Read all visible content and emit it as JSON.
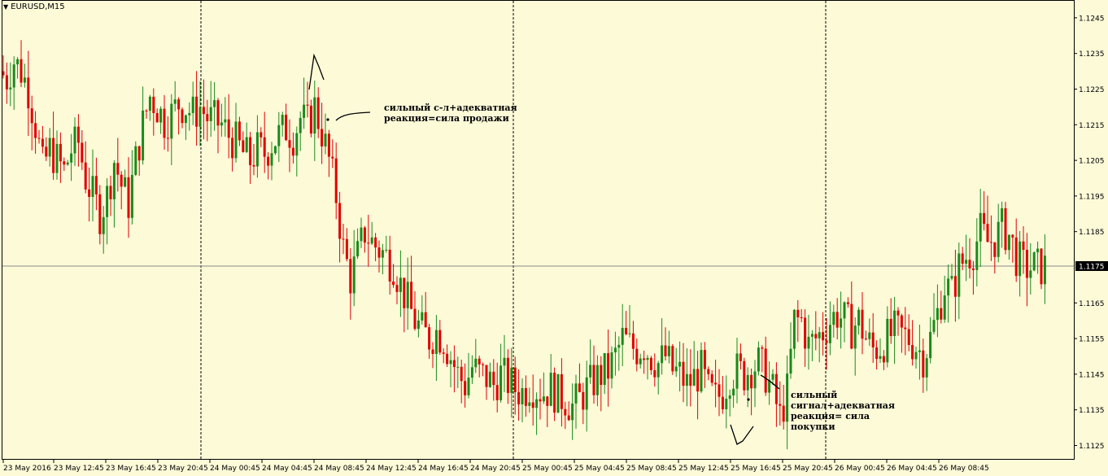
{
  "header": {
    "symbol": "EURUSD,M15"
  },
  "annotations": {
    "sell_note": "сильный с-л+адекватная\nреакция=сила продажи",
    "buy_note": "сильный\nсигнал+адекватная\nреакция= сила\nпокупки"
  },
  "colors": {
    "bull": "#1a8a1a",
    "bear": "#e00000",
    "background": "#fdfad8",
    "grid": "#000000",
    "price_line": "#8a8a8a"
  },
  "chart_data": {
    "type": "candlestick",
    "y_ticks": [
      "1.1245",
      "1.1235",
      "1.1225",
      "1.1215",
      "1.1205",
      "1.1195",
      "1.1185",
      "1.1165",
      "1.1155",
      "1.1145",
      "1.1135",
      "1.1125"
    ],
    "ylim": [
      1.1121,
      1.125
    ],
    "current_price": "1.1175",
    "x_ticks": [
      "23 May 2016",
      "23 May 12:45",
      "23 May 16:45",
      "23 May 20:45",
      "24 May 00:45",
      "24 May 04:45",
      "24 May 08:45",
      "24 May 12:45",
      "24 May 16:45",
      "24 May 20:45",
      "25 May 00:45",
      "25 May 04:45",
      "25 May 08:45",
      "25 May 12:45",
      "25 May 16:45",
      "25 May 20:45",
      "26 May 00:45",
      "26 May 04:45",
      "26 May 08:45"
    ],
    "session_separators": [
      "24 May 2016",
      "25 May 2016",
      "26 May 2016"
    ],
    "close_path": [
      [
        0,
        1.123
      ],
      [
        2,
        1.1228
      ],
      [
        4,
        1.1233
      ],
      [
        6,
        1.123
      ],
      [
        8,
        1.1225
      ],
      [
        10,
        1.1215
      ],
      [
        12,
        1.1203
      ],
      [
        14,
        1.1208
      ],
      [
        16,
        1.1205
      ],
      [
        18,
        1.1202
      ],
      [
        20,
        1.1208
      ],
      [
        22,
        1.121
      ],
      [
        24,
        1.12
      ],
      [
        26,
        1.1195
      ],
      [
        28,
        1.119
      ],
      [
        30,
        1.1195
      ],
      [
        32,
        1.1205
      ],
      [
        34,
        1.1198
      ],
      [
        36,
        1.1193
      ],
      [
        38,
        1.1205
      ],
      [
        40,
        1.1215
      ],
      [
        42,
        1.1223
      ],
      [
        44,
        1.122
      ],
      [
        46,
        1.1216
      ],
      [
        48,
        1.1218
      ],
      [
        50,
        1.1221
      ],
      [
        52,
        1.122
      ],
      [
        54,
        1.1218
      ],
      [
        56,
        1.122
      ],
      [
        58,
        1.1217
      ],
      [
        60,
        1.1216
      ],
      [
        62,
        1.1215
      ],
      [
        64,
        1.1212
      ],
      [
        66,
        1.121
      ],
      [
        68,
        1.1207
      ],
      [
        70,
        1.1205
      ],
      [
        72,
        1.1208
      ],
      [
        74,
        1.1207
      ],
      [
        76,
        1.121
      ],
      [
        78,
        1.1212
      ],
      [
        80,
        1.1214
      ],
      [
        82,
        1.1212
      ],
      [
        84,
        1.1217
      ],
      [
        86,
        1.1215
      ],
      [
        88,
        1.122
      ],
      [
        90,
        1.1213
      ],
      [
        92,
        1.1205
      ],
      [
        94,
        1.1195
      ],
      [
        96,
        1.118
      ],
      [
        98,
        1.1172
      ],
      [
        100,
        1.1178
      ],
      [
        102,
        1.1185
      ],
      [
        104,
        1.1182
      ],
      [
        106,
        1.118
      ],
      [
        108,
        1.1178
      ],
      [
        110,
        1.1176
      ],
      [
        112,
        1.117
      ],
      [
        114,
        1.1165
      ],
      [
        116,
        1.116
      ],
      [
        118,
        1.1157
      ],
      [
        120,
        1.1155
      ],
      [
        122,
        1.1157
      ],
      [
        124,
        1.1155
      ],
      [
        126,
        1.115
      ],
      [
        128,
        1.1145
      ],
      [
        130,
        1.1142
      ],
      [
        132,
        1.1147
      ],
      [
        134,
        1.1145
      ],
      [
        136,
        1.1144
      ],
      [
        138,
        1.1142
      ],
      [
        140,
        1.1145
      ],
      [
        142,
        1.1143
      ],
      [
        144,
        1.1141
      ],
      [
        146,
        1.114
      ],
      [
        148,
        1.1142
      ],
      [
        150,
        1.1141
      ],
      [
        152,
        1.114
      ],
      [
        154,
        1.1141
      ],
      [
        156,
        1.1139
      ],
      [
        158,
        1.1138
      ],
      [
        160,
        1.1136
      ],
      [
        162,
        1.1138
      ],
      [
        164,
        1.1141
      ],
      [
        166,
        1.1143
      ],
      [
        168,
        1.1145
      ],
      [
        170,
        1.1146
      ],
      [
        172,
        1.115
      ],
      [
        174,
        1.1155
      ],
      [
        176,
        1.1153
      ],
      [
        178,
        1.1152
      ],
      [
        180,
        1.1153
      ],
      [
        182,
        1.115
      ],
      [
        184,
        1.1148
      ],
      [
        186,
        1.115
      ],
      [
        188,
        1.1146
      ],
      [
        190,
        1.1145
      ],
      [
        192,
        1.1142
      ],
      [
        194,
        1.1144
      ],
      [
        196,
        1.1146
      ],
      [
        198,
        1.114
      ],
      [
        200,
        1.1138
      ],
      [
        202,
        1.114
      ],
      [
        204,
        1.1145
      ],
      [
        206,
        1.1146
      ],
      [
        208,
        1.1145
      ],
      [
        210,
        1.1147
      ],
      [
        212,
        1.1148
      ],
      [
        214,
        1.1145
      ],
      [
        216,
        1.114
      ],
      [
        218,
        1.1133
      ],
      [
        220,
        1.114
      ],
      [
        222,
        1.116
      ],
      [
        224,
        1.116
      ],
      [
        226,
        1.1153
      ],
      [
        228,
        1.1155
      ],
      [
        230,
        1.1157
      ],
      [
        232,
        1.116
      ],
      [
        234,
        1.1162
      ],
      [
        236,
        1.116
      ],
      [
        238,
        1.1158
      ],
      [
        240,
        1.116
      ],
      [
        242,
        1.1155
      ],
      [
        244,
        1.1152
      ],
      [
        246,
        1.1153
      ],
      [
        248,
        1.1155
      ],
      [
        250,
        1.1157
      ],
      [
        252,
        1.1156
      ],
      [
        254,
        1.1155
      ],
      [
        256,
        1.1153
      ],
      [
        258,
        1.115
      ],
      [
        260,
        1.1155
      ],
      [
        262,
        1.1162
      ],
      [
        264,
        1.117
      ],
      [
        266,
        1.1168
      ],
      [
        268,
        1.1175
      ],
      [
        270,
        1.1178
      ],
      [
        272,
        1.118
      ],
      [
        274,
        1.1185
      ],
      [
        276,
        1.1182
      ],
      [
        278,
        1.1183
      ],
      [
        280,
        1.1186
      ],
      [
        282,
        1.1184
      ],
      [
        284,
        1.1178
      ],
      [
        286,
        1.1175
      ]
    ]
  }
}
